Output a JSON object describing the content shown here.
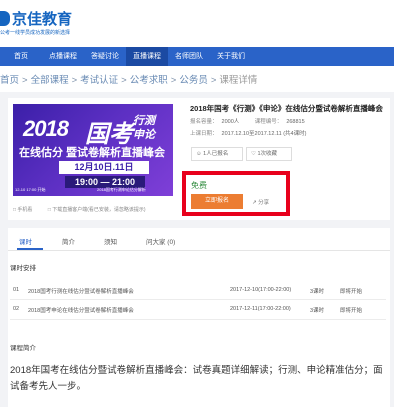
{
  "brand": {
    "name": "京佳教育",
    "slogan": "公考一线学员成功发展的新选择"
  },
  "nav": {
    "items": [
      {
        "label": "首页",
        "active": false
      },
      {
        "label": "点播课程",
        "active": false
      },
      {
        "label": "答疑讨论",
        "active": false
      },
      {
        "label": "直播课程",
        "active": true
      },
      {
        "label": "名师团队",
        "active": false
      },
      {
        "label": "关于我们",
        "active": false
      }
    ]
  },
  "breadcrumb": {
    "items": [
      "首页",
      "全部课程",
      "考试认证",
      "公考求职",
      "公务员"
    ],
    "current": "课程详情",
    "separator": ">"
  },
  "banner": {
    "year": "2018",
    "kao": "国考",
    "tag1": "行测",
    "tag2": "申论",
    "line": "在线估分 暨试卷解析直播峰会",
    "date": "12月10日.11日",
    "time": "19:00 — 21:00",
    "small_left": "12-10 17:00 开始",
    "small_right": "2018国考行测申论估分解析"
  },
  "course": {
    "title": "2018年国考《行测》《申论》在线估分暨试卷解析直播峰会",
    "meta": [
      {
        "label": "报名容量：",
        "value": "2000人",
        "extra_label": "课程编号：",
        "extra_value": "268815"
      },
      {
        "label": "上课日期：",
        "value": "2017.12.10至2017.12.11 (共4课时)"
      }
    ],
    "enrolled_label": "1人已报名",
    "favorite_label": "1次收藏",
    "price": "免费",
    "signup_label": "立即报名",
    "share_label": "分享",
    "bottom_left": "手机看",
    "bottom_right": "下载直播客户端(看已安装，请忽略该提示)"
  },
  "tabs": [
    {
      "label": "课时",
      "active": true
    },
    {
      "label": "简介",
      "active": false
    },
    {
      "label": "须知",
      "active": false
    },
    {
      "label": "问大家 (0)",
      "active": false
    }
  ],
  "schedule": {
    "title": "课时安排",
    "rows": [
      {
        "num": "01",
        "name": "2018国考行测在线估分暨试卷解析直播峰会",
        "time": "2017-12-10(17:00-22:00)",
        "duration": "3课时",
        "status": "即将开始"
      },
      {
        "num": "02",
        "name": "2018国考申论在线估分暨试卷解析直播峰会",
        "time": "2017-12-11(17:00-22:00)",
        "duration": "3课时",
        "status": "即将开始"
      }
    ]
  },
  "intro": {
    "title": "课程简介",
    "text": "2018年国考在线估分暨试卷解析直播峰会：试卷真题详细解读；行测、申论精准估分；面试备考先人一步。"
  },
  "colors": {
    "nav_bg": "#2a63c8",
    "accent_orange": "#ec7d32",
    "free_green": "#2e8b3c",
    "highlight_red": "#e8001c"
  }
}
